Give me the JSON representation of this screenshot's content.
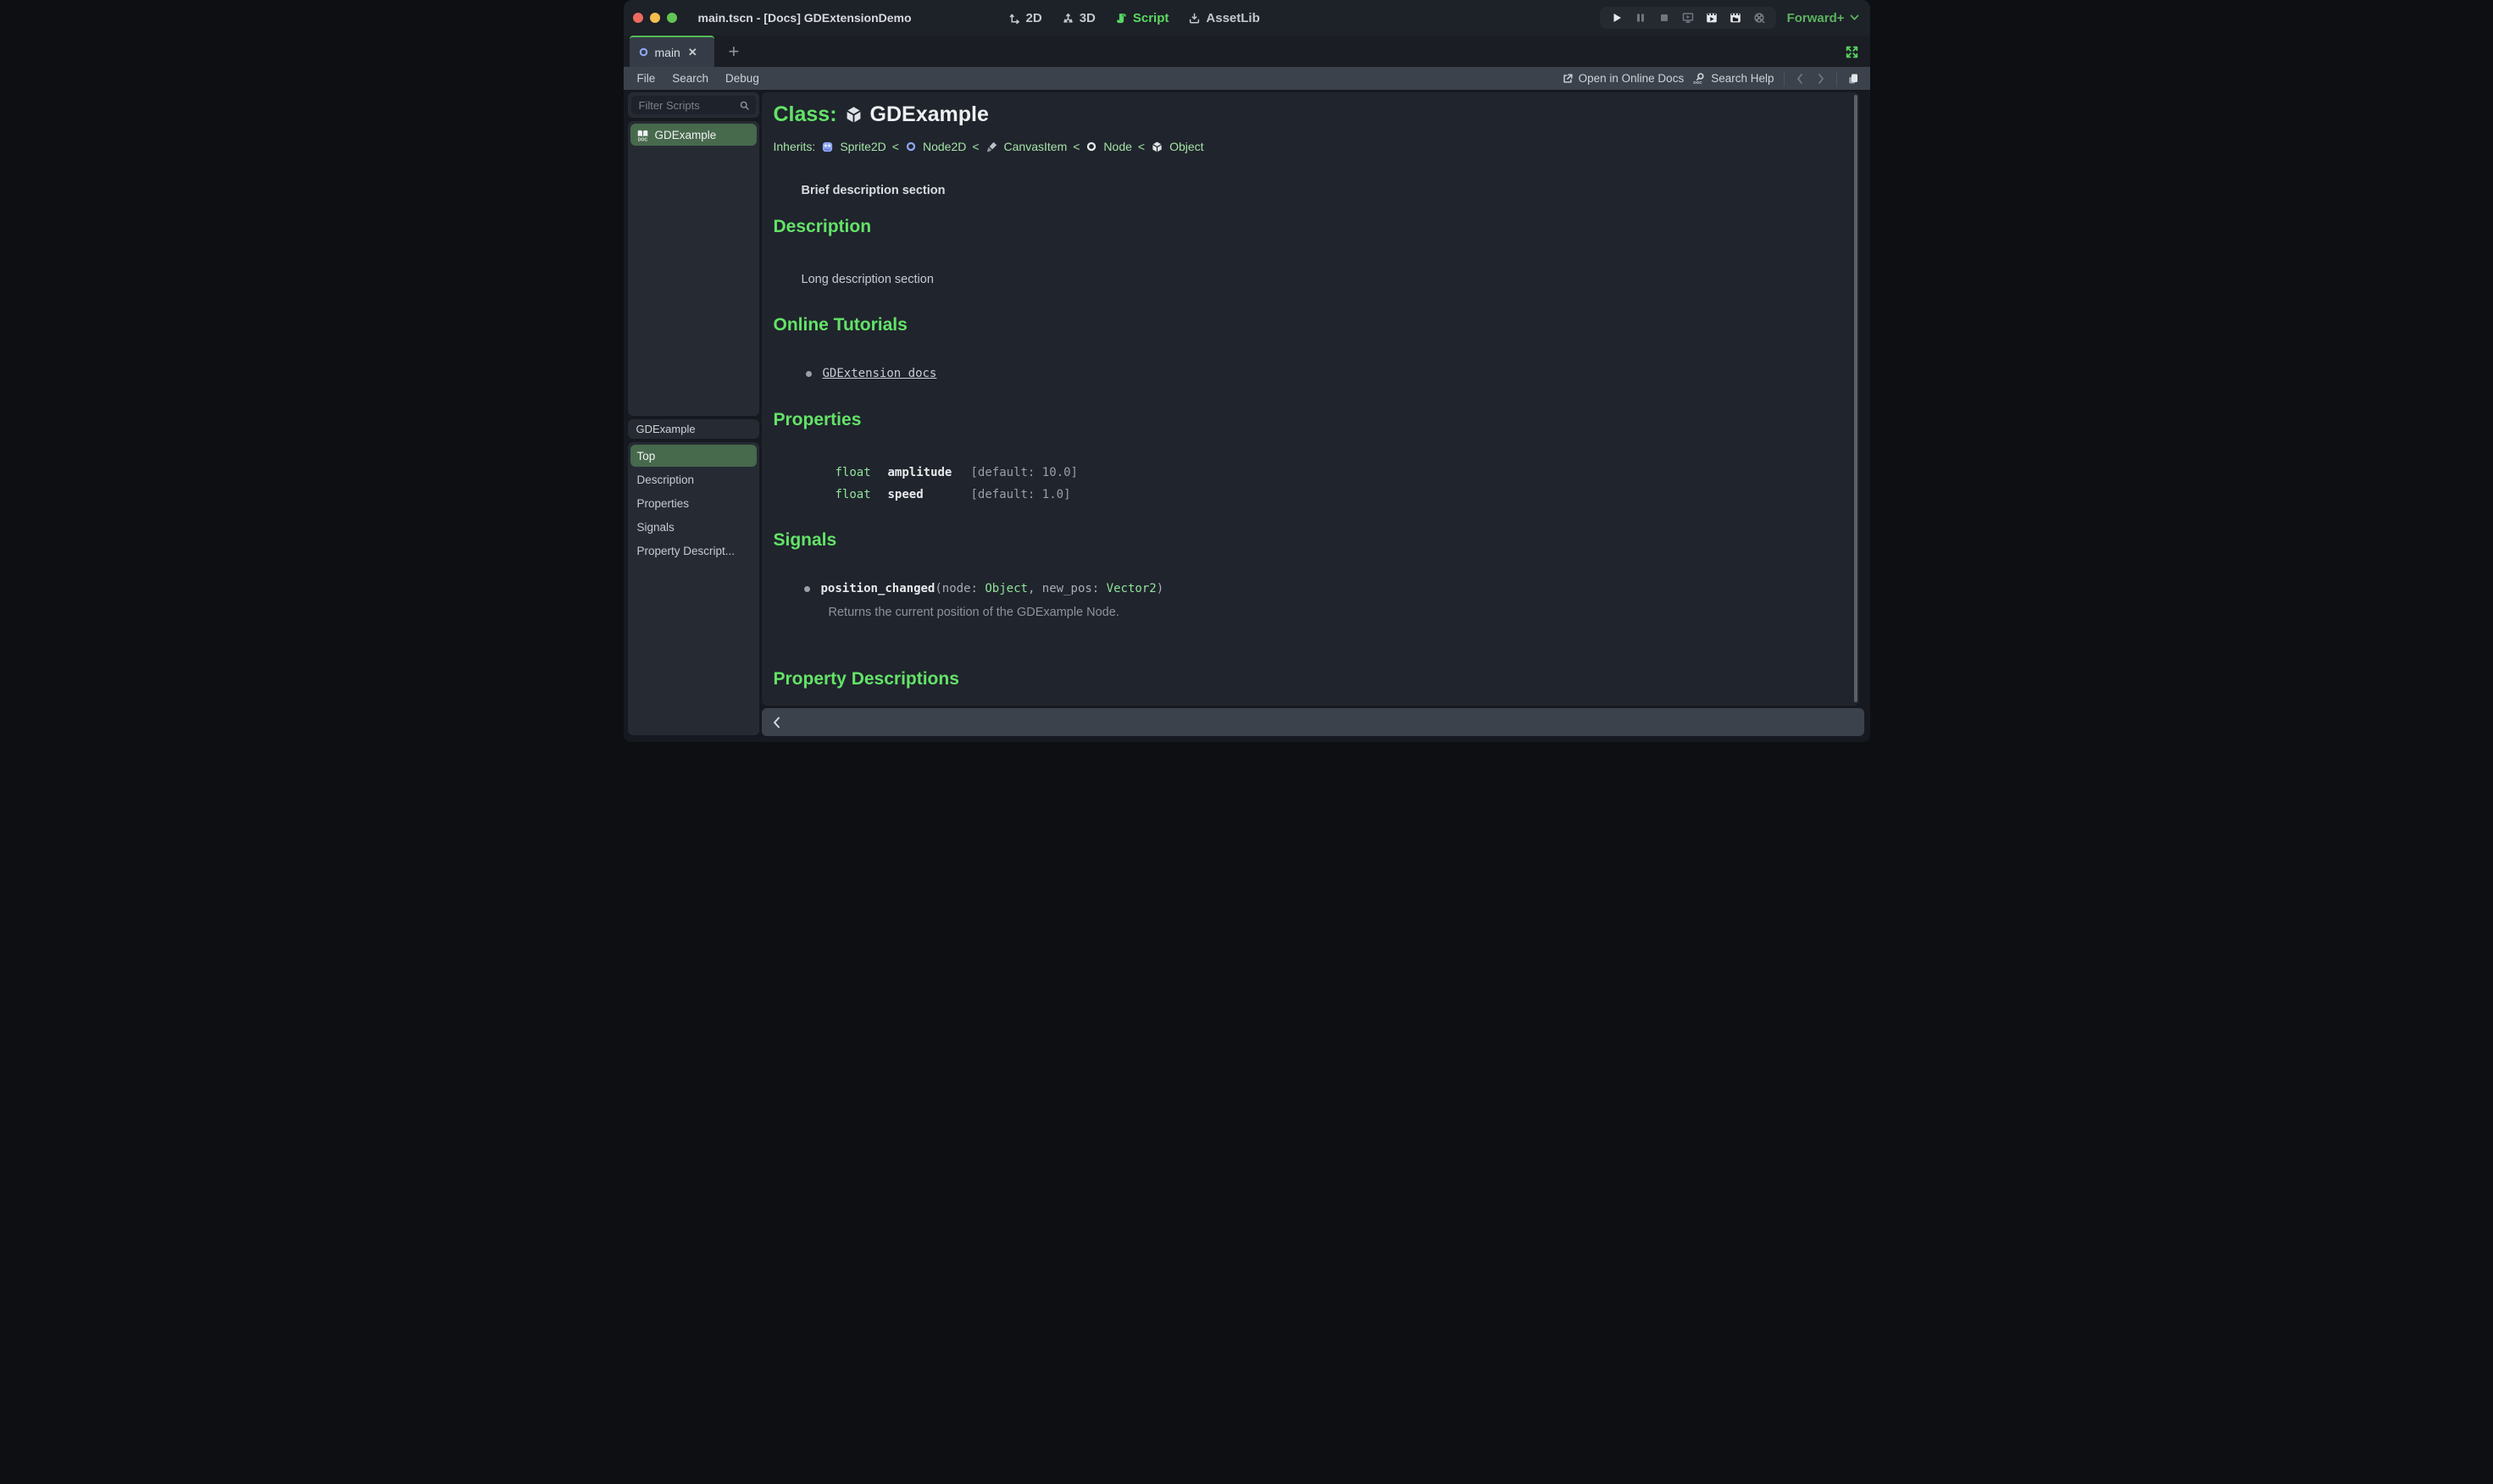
{
  "colors": {
    "accent_green": "#63e368",
    "selection_green": "#47694c",
    "node_blue": "#8da5f3",
    "renderer_green": "#5bb35f",
    "tab_accent": "#55b95a"
  },
  "titlebar": {
    "title": "main.tscn - [Docs] GDExtensionDemo",
    "renderer": "Forward+",
    "workspace_tabs": [
      {
        "label": "2D",
        "active": false
      },
      {
        "label": "3D",
        "active": false
      },
      {
        "label": "Script",
        "active": true
      },
      {
        "label": "AssetLib",
        "active": false
      }
    ]
  },
  "scene_tabs": {
    "active_tab": "main",
    "add_label": "+",
    "close_label": "✕"
  },
  "menubar": {
    "items": [
      "File",
      "Search",
      "Debug"
    ],
    "open_online_docs": "Open in Online Docs",
    "search_help": "Search Help"
  },
  "sidebar": {
    "filter_placeholder": "Filter Scripts",
    "scripts": [
      {
        "label": "GDExample",
        "selected": true
      }
    ],
    "member_list_header": "GDExample",
    "members": [
      {
        "label": "Top",
        "selected": true
      },
      {
        "label": "Description",
        "selected": false
      },
      {
        "label": "Properties",
        "selected": false
      },
      {
        "label": "Signals",
        "selected": false
      },
      {
        "label": "Property Descript...",
        "selected": false
      }
    ]
  },
  "help": {
    "class_label": "Class:",
    "class_name": "GDExample",
    "inherits_label": "Inherits:",
    "separator": "<",
    "inherits": [
      {
        "name": "Sprite2D"
      },
      {
        "name": "Node2D"
      },
      {
        "name": "CanvasItem"
      },
      {
        "name": "Node"
      },
      {
        "name": "Object"
      }
    ],
    "brief_description": "Brief description section",
    "description_heading": "Description",
    "description_text": "Long description section",
    "tutorials_heading": "Online Tutorials",
    "tutorial_link": "GDExtension docs",
    "properties_heading": "Properties",
    "properties": [
      {
        "type": "float",
        "name": "amplitude",
        "default": "[default: 10.0]"
      },
      {
        "type": "float",
        "name": "speed",
        "default": "[default: 1.0]"
      }
    ],
    "signals_heading": "Signals",
    "signal": {
      "name": "position_changed",
      "part1": "(node: ",
      "type1": "Object",
      "part2": ", new_pos: ",
      "type2": "Vector2",
      "part3": ")",
      "description": "Returns the current position of the GDExample Node."
    },
    "property_descriptions_heading": "Property Descriptions"
  },
  "icons": {
    "doc_badge": "DOC"
  }
}
